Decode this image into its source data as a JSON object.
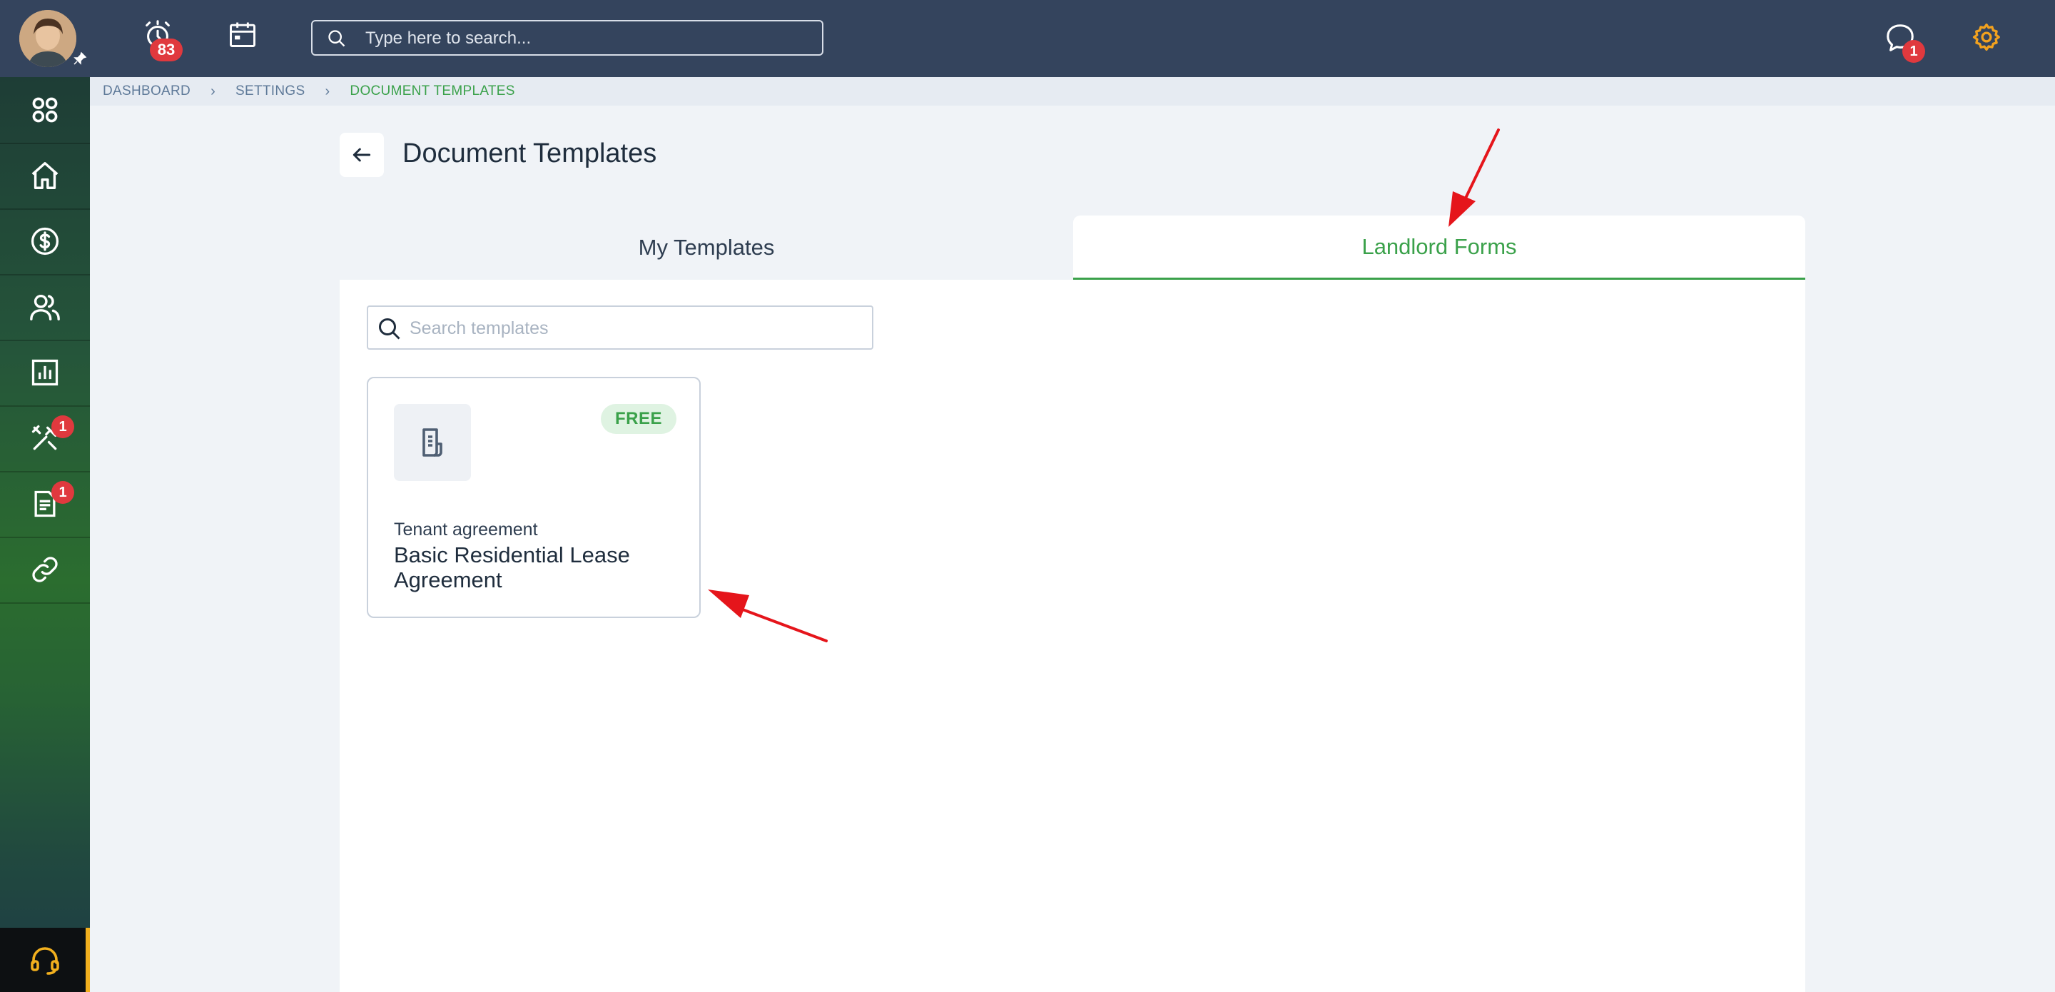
{
  "colors": {
    "topbar": "#34445d",
    "accent_green": "#3aa14a",
    "badge_red": "#e0393e",
    "settings_orange": "#f2a21e",
    "annotation_red": "#e5151b"
  },
  "topbar": {
    "notifications_count": "83",
    "search_placeholder": "Type here to search...",
    "messages_count": "1",
    "icons": [
      "avatar",
      "pin-icon",
      "alarm-icon",
      "calendar-icon",
      "search-icon",
      "chat-icon",
      "gear-icon"
    ]
  },
  "sidebar": {
    "items": [
      {
        "name": "apps",
        "icon": "apps-icon",
        "badge": ""
      },
      {
        "name": "home",
        "icon": "home-icon",
        "badge": ""
      },
      {
        "name": "finance",
        "icon": "dollar-icon",
        "badge": ""
      },
      {
        "name": "people",
        "icon": "users-icon",
        "badge": ""
      },
      {
        "name": "reports",
        "icon": "chart-icon",
        "badge": ""
      },
      {
        "name": "maintenance",
        "icon": "tools-icon",
        "badge": "1"
      },
      {
        "name": "documents",
        "icon": "document-icon",
        "badge": "1"
      },
      {
        "name": "links",
        "icon": "link-icon",
        "badge": ""
      }
    ],
    "help_icon": "headset-icon"
  },
  "breadcrumb": {
    "items": [
      "DASHBOARD",
      "SETTINGS",
      "DOCUMENT TEMPLATES"
    ]
  },
  "page": {
    "title": "Document Templates"
  },
  "tabs": [
    {
      "label": "My Templates",
      "active": false
    },
    {
      "label": "Landlord Forms",
      "active": true
    }
  ],
  "templates": {
    "search_placeholder": "Search templates",
    "cards": [
      {
        "badge": "FREE",
        "category": "Tenant agreement",
        "name": "Basic Residential Lease Agreement",
        "icon": "document-icon"
      }
    ]
  }
}
